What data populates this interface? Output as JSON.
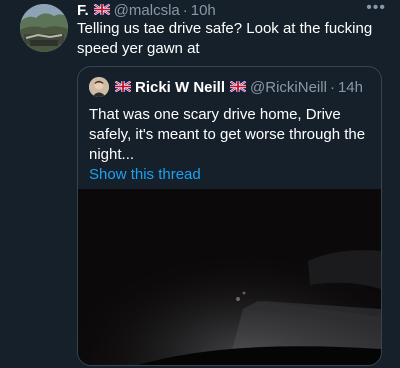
{
  "tweet": {
    "author_name": "F.",
    "author_handle": "@malcsla",
    "separator": "·",
    "time": "10h",
    "more": "•••",
    "text": "Telling us tae drive safe? Look at the fucking speed yer gawn at"
  },
  "quoted_tweet": {
    "author_name": "Ricki W Neill",
    "author_handle": "@RickiNeill",
    "separator": "·",
    "time": "14h",
    "text": "That was one scary drive home, Drive safely, it's meant to get worse through the night...",
    "show_thread_label": "Show this thread"
  },
  "colors": {
    "background": "#15202b",
    "border": "#38444d",
    "muted_text": "#8899a6",
    "link": "#1da1f2"
  },
  "icons": {
    "flag": "uk-flag-icon",
    "more": "more-icon"
  }
}
